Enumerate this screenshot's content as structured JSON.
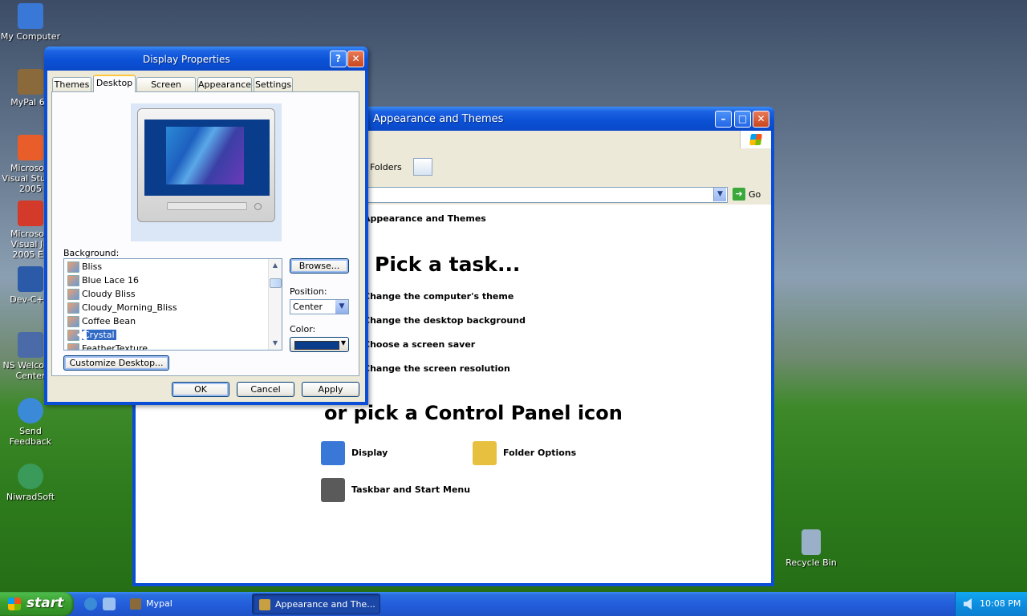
{
  "desktop": {
    "icons": [
      {
        "label": "My Computer",
        "color": "#3a78d8"
      },
      {
        "label": "MyPal 68",
        "color": "#8a6a3a"
      },
      {
        "label": "Microsoft Visual Studio 2005",
        "color": "#e85d2a"
      },
      {
        "label": "Microsoft Visual J# 2005 Ex",
        "color": "#d43a2a"
      },
      {
        "label": "Dev-C++",
        "color": "#2a5aa8"
      },
      {
        "label": "NS Welcome Center",
        "color": "#4a6aa8"
      },
      {
        "label": "Send Feedback",
        "color": "#3a8ad8"
      },
      {
        "label": "NiwradSoft",
        "color": "#3a9a5a"
      },
      {
        "label": "Recycle Bin",
        "color": "#9ab0c8"
      }
    ]
  },
  "taskbar": {
    "start_label": "start",
    "items": [
      {
        "label": "Mypal",
        "icon": "mypal-icon",
        "color": "#8a6a3a"
      },
      {
        "label": "Appearance and The...",
        "icon": "control-panel-icon",
        "color": "#c8a040"
      }
    ],
    "clock": "10:08 PM"
  },
  "explorer": {
    "title": "Appearance and Themes",
    "toolbar_folders": "Folders",
    "go_label": "Go",
    "breadcrumb": "Appearance and Themes",
    "pick_task": "Pick a task...",
    "tasks": [
      "Change the computer's theme",
      "Change the desktop background",
      "Choose a screen saver",
      "Change the screen resolution"
    ],
    "or_pick": "or pick a Control Panel icon",
    "icons": [
      {
        "label": "Display",
        "icon": "display-icon",
        "color": "#3a78d8"
      },
      {
        "label": "Folder Options",
        "icon": "folder-options-icon",
        "color": "#e8c040"
      },
      {
        "label": "Taskbar and Start Menu",
        "icon": "taskbar-start-menu-icon",
        "color": "#5a5a5a"
      }
    ]
  },
  "dialog": {
    "title": "Display Properties",
    "help": "?",
    "close": "✕",
    "tabs": [
      "Themes",
      "Desktop",
      "Screen Saver",
      "Appearance",
      "Settings"
    ],
    "selected_tab": "Desktop",
    "background_label": "Background:",
    "backgrounds": [
      "Bliss",
      "Blue Lace 16",
      "Cloudy Bliss",
      "Cloudy_Morning_Bliss",
      "Coffee Bean",
      "Crystal",
      "FeatherTexture"
    ],
    "selected_background": "Crystal",
    "browse_label": "Browse...",
    "position_label": "Position:",
    "position_value": "Center",
    "color_label": "Color:",
    "color_value": "#0a3c8c",
    "customize_label": "Customize Desktop...",
    "ok_label": "OK",
    "cancel_label": "Cancel",
    "apply_label": "Apply"
  }
}
